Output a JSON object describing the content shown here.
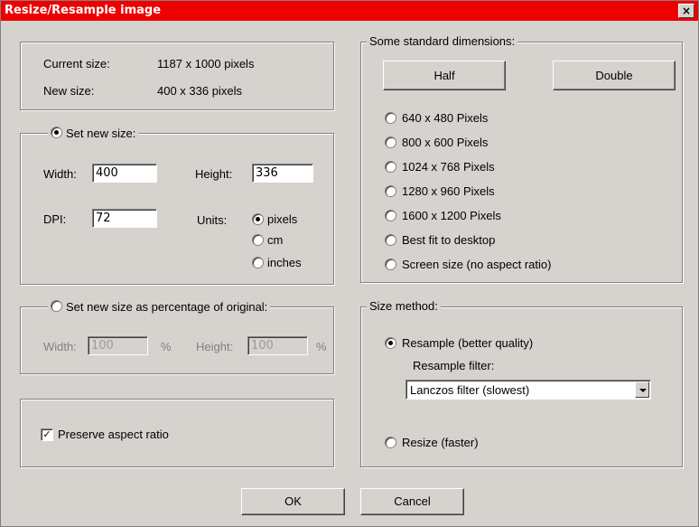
{
  "window": {
    "title": "Resize/Resample image",
    "close": "×"
  },
  "info": {
    "current_label": "Current size:",
    "current_value": "1187 x 1000 pixels",
    "new_label": "New size:",
    "new_value": "400 x 336 pixels"
  },
  "new_size": {
    "legend": "Set new size:",
    "width_label": "Width:",
    "width_value": "400",
    "height_label": "Height:",
    "height_value": "336",
    "dpi_label": "DPI:",
    "dpi_value": "72",
    "units_label": "Units:",
    "units": [
      "pixels",
      "cm",
      "inches"
    ],
    "selected_unit": "pixels"
  },
  "percent": {
    "legend": "Set new size as percentage of original:",
    "width_label": "Width:",
    "width_value": "100",
    "pct1": "%",
    "height_label": "Height:",
    "height_value": "100",
    "pct2": "%"
  },
  "aspect": {
    "label": "Preserve aspect ratio",
    "checked": true
  },
  "standard": {
    "legend": "Some standard dimensions:",
    "half": "Half",
    "double": "Double",
    "options": [
      "640 x 480 Pixels",
      "800 x 600 Pixels",
      "1024 x 768 Pixels",
      "1280 x 960 Pixels",
      "1600 x 1200 Pixels",
      "Best fit to desktop",
      "Screen size (no aspect ratio)"
    ]
  },
  "method": {
    "legend": "Size method:",
    "resample": "Resample (better quality)",
    "filter_label": "Resample filter:",
    "filter_value": "Lanczos filter (slowest)",
    "resize": "Resize (faster)"
  },
  "buttons": {
    "ok": "OK",
    "cancel": "Cancel"
  },
  "colors": {
    "titlebar": "#ee0000",
    "face": "#d6d3ce"
  }
}
